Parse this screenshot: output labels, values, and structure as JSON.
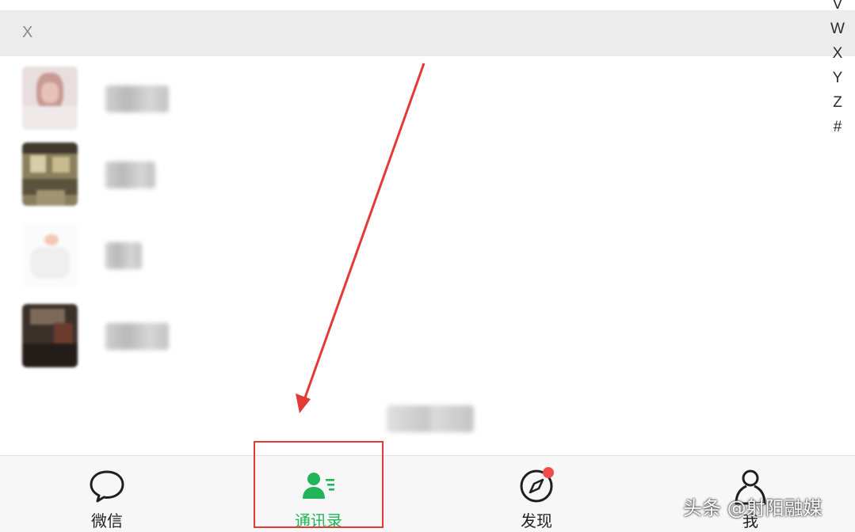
{
  "index_header": {
    "close_glyph": "X"
  },
  "alpha_index": [
    "V",
    "W",
    "X",
    "Y",
    "Z",
    "#"
  ],
  "contacts": [
    {
      "name": "████"
    },
    {
      "name": "███"
    },
    {
      "name": "██"
    },
    {
      "name": "████"
    }
  ],
  "contact_count": "████",
  "tabbar": {
    "tabs": [
      {
        "label": "微信",
        "icon": "chat-bubble-icon"
      },
      {
        "label": "通讯录",
        "icon": "contacts-icon",
        "active": true
      },
      {
        "label": "发现",
        "icon": "compass-icon",
        "badge": true
      },
      {
        "label": "我",
        "icon": "person-icon"
      }
    ]
  },
  "annotation": {
    "color": "#e23a36"
  },
  "watermark": "头条 @射阳融媒",
  "colors": {
    "accent": "#20b55a",
    "badge": "#f24a4a",
    "header_bg": "#ececec"
  }
}
